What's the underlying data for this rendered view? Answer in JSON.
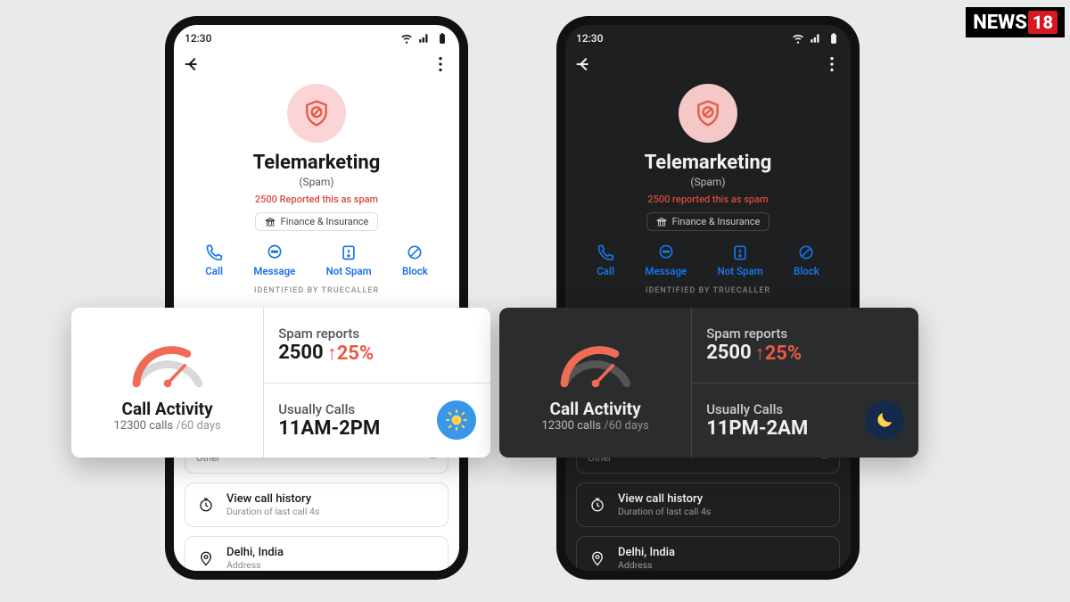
{
  "watermark": {
    "brand": "NEWS",
    "num": "18"
  },
  "statusbar": {
    "time": "12:30"
  },
  "profile": {
    "name": "Telemarketing",
    "tag": "(Spam)",
    "category": "Finance & Insurance",
    "identified": "IDENTIFIED BY TRUECALLER"
  },
  "actions": {
    "call": "Call",
    "message": "Message",
    "notspam": "Not Spam",
    "block": "Block"
  },
  "cards": {
    "other_label": "Other",
    "history_title": "View call history",
    "history_sub": "Duration of last call 4s",
    "location_title": "Delhi, India",
    "location_sub": "Address"
  },
  "overlay": {
    "activity_title": "Call Activity",
    "activity_calls": "12300 calls",
    "activity_period": "/60 days",
    "spam_label": "Spam reports",
    "spam_value": "2500",
    "spam_pct": "25%",
    "usually_label": "Usually Calls"
  },
  "light": {
    "spam_line": "2500 Reported this as spam",
    "usually_time": "11AM-2PM"
  },
  "dark": {
    "spam_line": "2500 reported this as spam",
    "usually_time": "11PM-2AM"
  }
}
